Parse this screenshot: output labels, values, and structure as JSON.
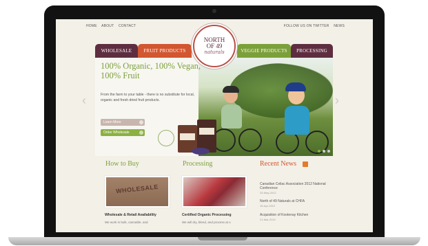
{
  "topnav": {
    "left": [
      "HOME",
      "ABOUT",
      "CONTACT"
    ],
    "right": [
      "FOLLOW US ON TWITTER",
      "NEWS"
    ]
  },
  "logo": {
    "line1": "NORTH",
    "line2": "OF 49",
    "line3": "naturals"
  },
  "tabs": [
    {
      "label": "WHOLESALE",
      "color": "#5e2e40"
    },
    {
      "label": "FRUIT PRODUCTS",
      "color": "#d2562f"
    },
    {
      "label": "VEGGIE PRODUCTS",
      "color": "#7ba03a"
    },
    {
      "label": "PROCESSING",
      "color": "#5e2e40"
    }
  ],
  "hero": {
    "headline": "100% Organic, 100% Vegan, 100% Fruit",
    "sub": "From the farm to your table - there is no substitute for local, organic and fresh dried fruit products.",
    "learn_label": "Learn More",
    "order_label": "Order Wholesale",
    "slide_count": 3,
    "active_slide": 1
  },
  "sections": {
    "buy_title": "How to Buy",
    "processing_title": "Processing",
    "news_title": "Recent News"
  },
  "cards": {
    "wholesale_stamp": "WHOLESALE",
    "wholesale_caption": "Wholesale & Retail Availability",
    "wholesale_sub": "We work in bulk, cannable, and",
    "processing_caption": "Certified Organic Processing",
    "processing_sub": "We will dry, blend, and process at o"
  },
  "news": [
    {
      "title": "Canadian Celiac Association 2012 National Conference",
      "date": "25-May-2012"
    },
    {
      "title": "North of 49 Naturals at CHFA",
      "date": "18-Apr-2012"
    },
    {
      "title": "Acquisition of Kootenay Kitchen",
      "date": "21-Mar-2012"
    }
  ],
  "colors": {
    "green": "#7ba03a",
    "orange": "#d2562f",
    "plum": "#5e2e40"
  }
}
